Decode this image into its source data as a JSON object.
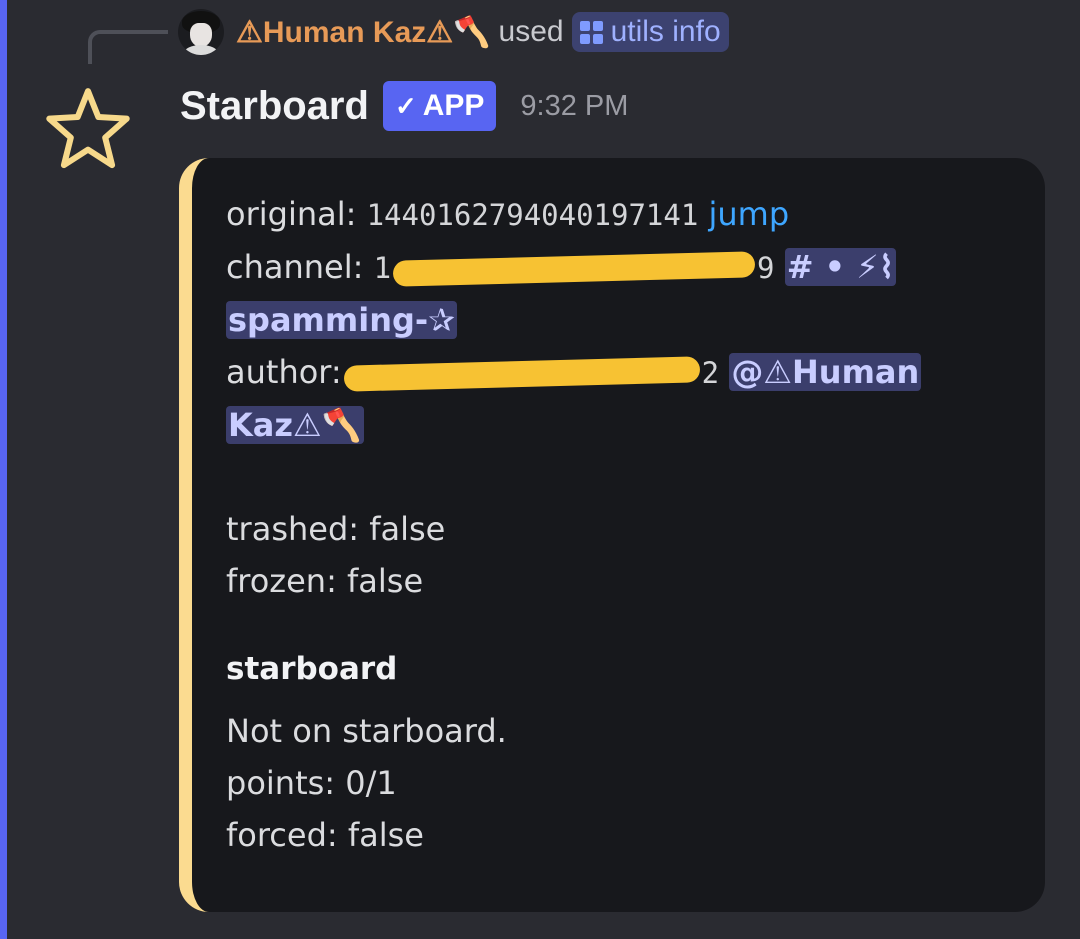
{
  "reply": {
    "user": "⚠Human Kaz⚠🪓",
    "used": "used",
    "command": "utils info"
  },
  "message": {
    "bot_name": "Starboard",
    "badge": "APP",
    "time": "9:32 PM"
  },
  "embed": {
    "accent_color": "#fbdb90",
    "original_label": "original:",
    "original_id": "1440162794040197141",
    "jump_label": "jump",
    "channel_label": "channel:",
    "channel_id_visible_start": "1",
    "channel_id_visible_end": "9",
    "channel_mention_line1": "# • ⚡⌇",
    "channel_mention_line2": "spamming-✰",
    "author_label": "author:",
    "author_id_visible_end": "2",
    "author_mention_line1": "@⚠Human",
    "author_mention_line2": "Kaz⚠🪓",
    "trashed": "trashed: false",
    "frozen": "frozen: false",
    "section_title": "starboard",
    "status": "Not on starboard.",
    "points": "points: 0/1",
    "forced": "forced: false"
  },
  "colors": {
    "background": "#2a2b31",
    "highlight": "#5865f2",
    "embed_bg": "#17181c",
    "link": "#3ea6ff",
    "mention_bg": "#3b3e6c",
    "reply_user": "#e79a57",
    "redaction": "#f7c233"
  },
  "icons": {
    "bot_avatar": "star-outline-icon",
    "command": "grid-icon",
    "badge": "checkmark-icon"
  }
}
